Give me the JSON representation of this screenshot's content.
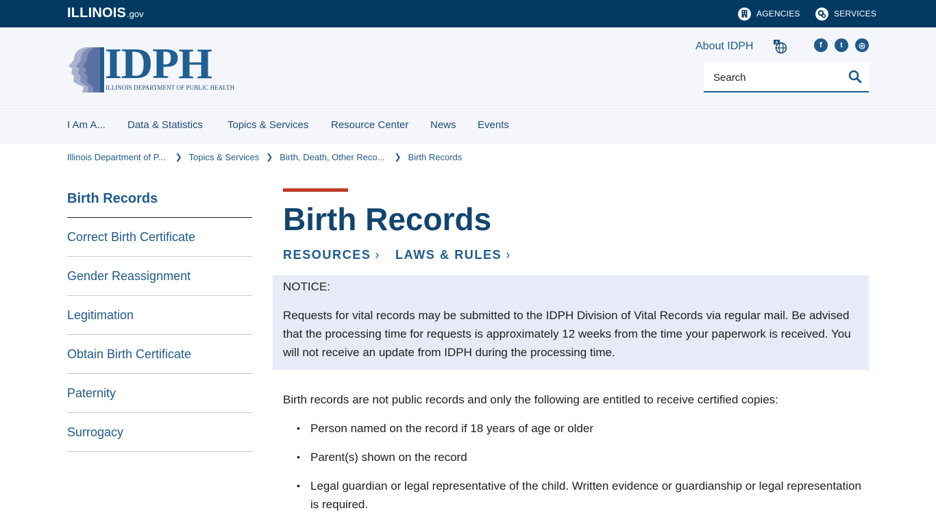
{
  "topbar": {
    "logo_main": "ILLINOIS",
    "logo_gov": ".gov",
    "agencies_label": "AGENCIES",
    "services_label": "SERVICES"
  },
  "header": {
    "logo_text": "IDPH",
    "logo_subtitle": "ILLINOIS DEPARTMENT OF PUBLIC HEALTH",
    "about_label": "About IDPH",
    "search_placeholder": "Search",
    "social": {
      "facebook": "f",
      "twitter": "t",
      "instagram": "◎"
    }
  },
  "nav": {
    "items": [
      "I Am A...",
      "Data & Statistics",
      "Topics & Services",
      "Resource Center",
      "News",
      "Events"
    ]
  },
  "breadcrumb": [
    "Illinois Department of P...",
    "Topics & Services",
    "Birth, Death, Other Reco...",
    "Birth Records"
  ],
  "sidebar": {
    "title": "Birth Records",
    "items": [
      "Correct Birth Certificate",
      "Gender Reassignment",
      "Legitimation",
      "Obtain Birth Certificate",
      "Paternity",
      "Surrogacy"
    ]
  },
  "main": {
    "title": "Birth Records",
    "sublinks": [
      "RESOURCES",
      "LAWS & RULES"
    ],
    "notice_heading": "NOTICE:",
    "notice_body": "Requests for vital records may be submitted to the IDPH Division of Vital Records via regular mail. Be advised that the processing time for requests is approximately 12 weeks from the time your paperwork is received. You will not receive an update from IDPH during the processing time.",
    "intro": "Birth records are not public records and only the following are entitled to receive certified copies:",
    "bullets": [
      "Person named on the record if 18 years of age or older",
      "Parent(s) shown on the record",
      "Legal guardian or legal representative of the child. Written evidence or guardianship or legal representation is required."
    ]
  },
  "colors": {
    "topbar": "#003a63",
    "brand_blue": "#1f5a8c",
    "accent_red": "#c0392b",
    "notice_bg": "#e6ebf7"
  }
}
